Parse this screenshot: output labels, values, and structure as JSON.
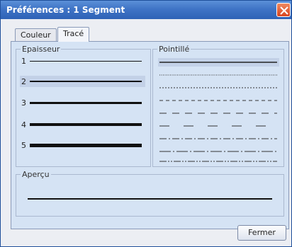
{
  "window": {
    "title": "Préférences : 1 Segment"
  },
  "tabs": [
    {
      "label": "Couleur",
      "active": false
    },
    {
      "label": "Tracé",
      "active": true
    }
  ],
  "epaisseur": {
    "label": "Epaisseur",
    "items": [
      {
        "label": "1",
        "selected": false
      },
      {
        "label": "2",
        "selected": true
      },
      {
        "label": "3",
        "selected": false
      },
      {
        "label": "4",
        "selected": false
      },
      {
        "label": "5",
        "selected": false
      }
    ]
  },
  "pointille": {
    "label": "Pointillé",
    "items": [
      {
        "style": "solid",
        "selected": true
      },
      {
        "style": "dotted-fine",
        "selected": false
      },
      {
        "style": "dotted",
        "selected": false
      },
      {
        "style": "dashed-short",
        "selected": false
      },
      {
        "style": "dashed-medium",
        "selected": false
      },
      {
        "style": "dashed-long",
        "selected": false
      },
      {
        "style": "dash-dot",
        "selected": false
      },
      {
        "style": "dash-dot-long",
        "selected": false
      },
      {
        "style": "dash-dot-dot",
        "selected": false
      }
    ]
  },
  "apercu": {
    "label": "Aperçu"
  },
  "buttons": {
    "close_label": "Fermer"
  },
  "colors": {
    "titlebar": "#3f74c6",
    "panel": "#d5e3f4",
    "selection": "#c3d1e7",
    "close": "#d8431e"
  }
}
